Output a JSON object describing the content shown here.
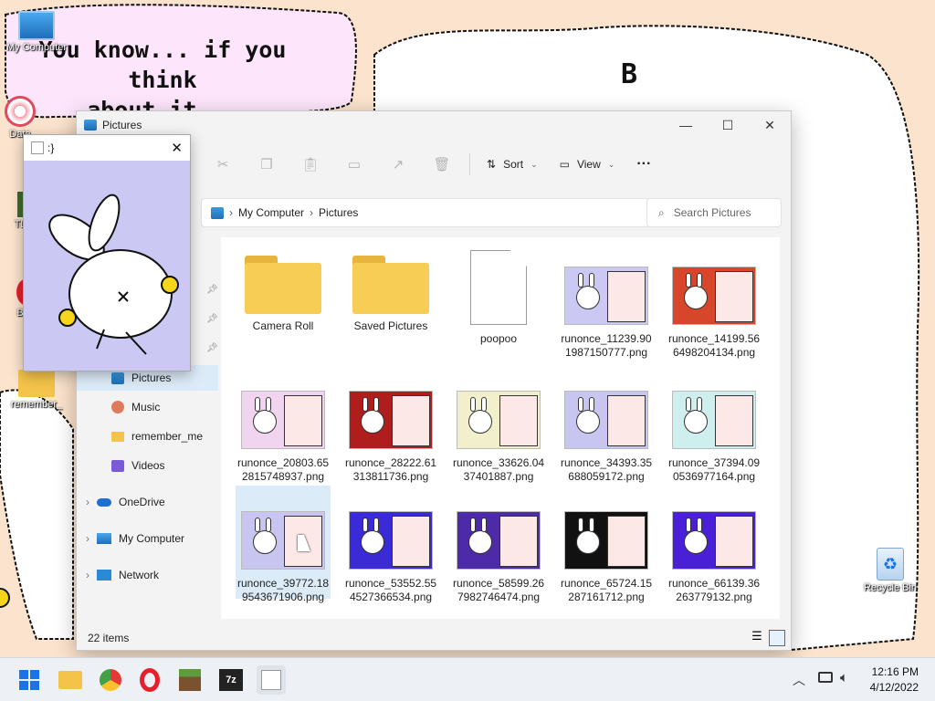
{
  "desktop": {
    "speech_line1": "You know... if you think",
    "speech_line2": "about it...",
    "bubble_letter": "B",
    "icons": [
      {
        "label": "My Computer"
      },
      {
        "label": "Data"
      },
      {
        "label": "TL"
      },
      {
        "label": "B"
      },
      {
        "label": "remember_"
      },
      {
        "label": "Recycle Bin"
      }
    ]
  },
  "popup": {
    "title": ":}"
  },
  "explorer": {
    "title": "Pictures",
    "toolbar": {
      "sort": "Sort",
      "view": "View",
      "more": "···"
    },
    "address": [
      "My Computer",
      "Pictures"
    ],
    "search_placeholder": "Search Pictures",
    "nav": [
      {
        "label": "Pictures",
        "icon": "pictures-icon"
      },
      {
        "label": "Music",
        "icon": "music-icon"
      },
      {
        "label": "remember_me",
        "icon": "folder-icon"
      },
      {
        "label": "Videos",
        "icon": "videos-icon"
      },
      {
        "label": "OneDrive",
        "icon": "onedrive-icon"
      },
      {
        "label": "My Computer",
        "icon": "computer-icon"
      },
      {
        "label": "Network",
        "icon": "network-icon"
      }
    ],
    "files": [
      {
        "name": "Camera Roll",
        "kind": "folder"
      },
      {
        "name": "Saved Pictures",
        "kind": "folder"
      },
      {
        "name": "poopoo",
        "kind": "file"
      },
      {
        "name": "runonce_11239.901987150777.png",
        "kind": "image",
        "bg": "#cbc9f4"
      },
      {
        "name": "runonce_14199.566498204134.png",
        "kind": "image",
        "bg": "#d7462a"
      },
      {
        "name": "runonce_20803.652815748937.png",
        "kind": "image",
        "bg": "#f0d4f0"
      },
      {
        "name": "runonce_28222.61313811736.png",
        "kind": "image",
        "bg": "#b01d1d"
      },
      {
        "name": "runonce_33626.0437401887.png",
        "kind": "image",
        "bg": "#f2f0cc"
      },
      {
        "name": "runonce_34393.35688059172.png",
        "kind": "image",
        "bg": "#c8c6f0"
      },
      {
        "name": "runonce_37394.090536977164.png",
        "kind": "image",
        "bg": "#cfeeee"
      },
      {
        "name": "runonce_39772.189543671906.png",
        "kind": "image",
        "bg": "#c8c6f0"
      },
      {
        "name": "runonce_53552.554527366534.png",
        "kind": "image",
        "bg": "#3a2bd6"
      },
      {
        "name": "runonce_58599.267982746474.png",
        "kind": "image",
        "bg": "#4d2aa8"
      },
      {
        "name": "runonce_65724.15287161712.png",
        "kind": "image",
        "bg": "#111111"
      },
      {
        "name": "runonce_66139.36263779132.png",
        "kind": "image",
        "bg": "#4a1fd8"
      }
    ],
    "status": "22 items"
  },
  "taskbar": {
    "time": "12:16 PM",
    "date": "4/12/2022"
  },
  "colors": {
    "accent": "#1a73e8",
    "selected": "#dcebf8",
    "taskbar": "#edf0f5"
  }
}
